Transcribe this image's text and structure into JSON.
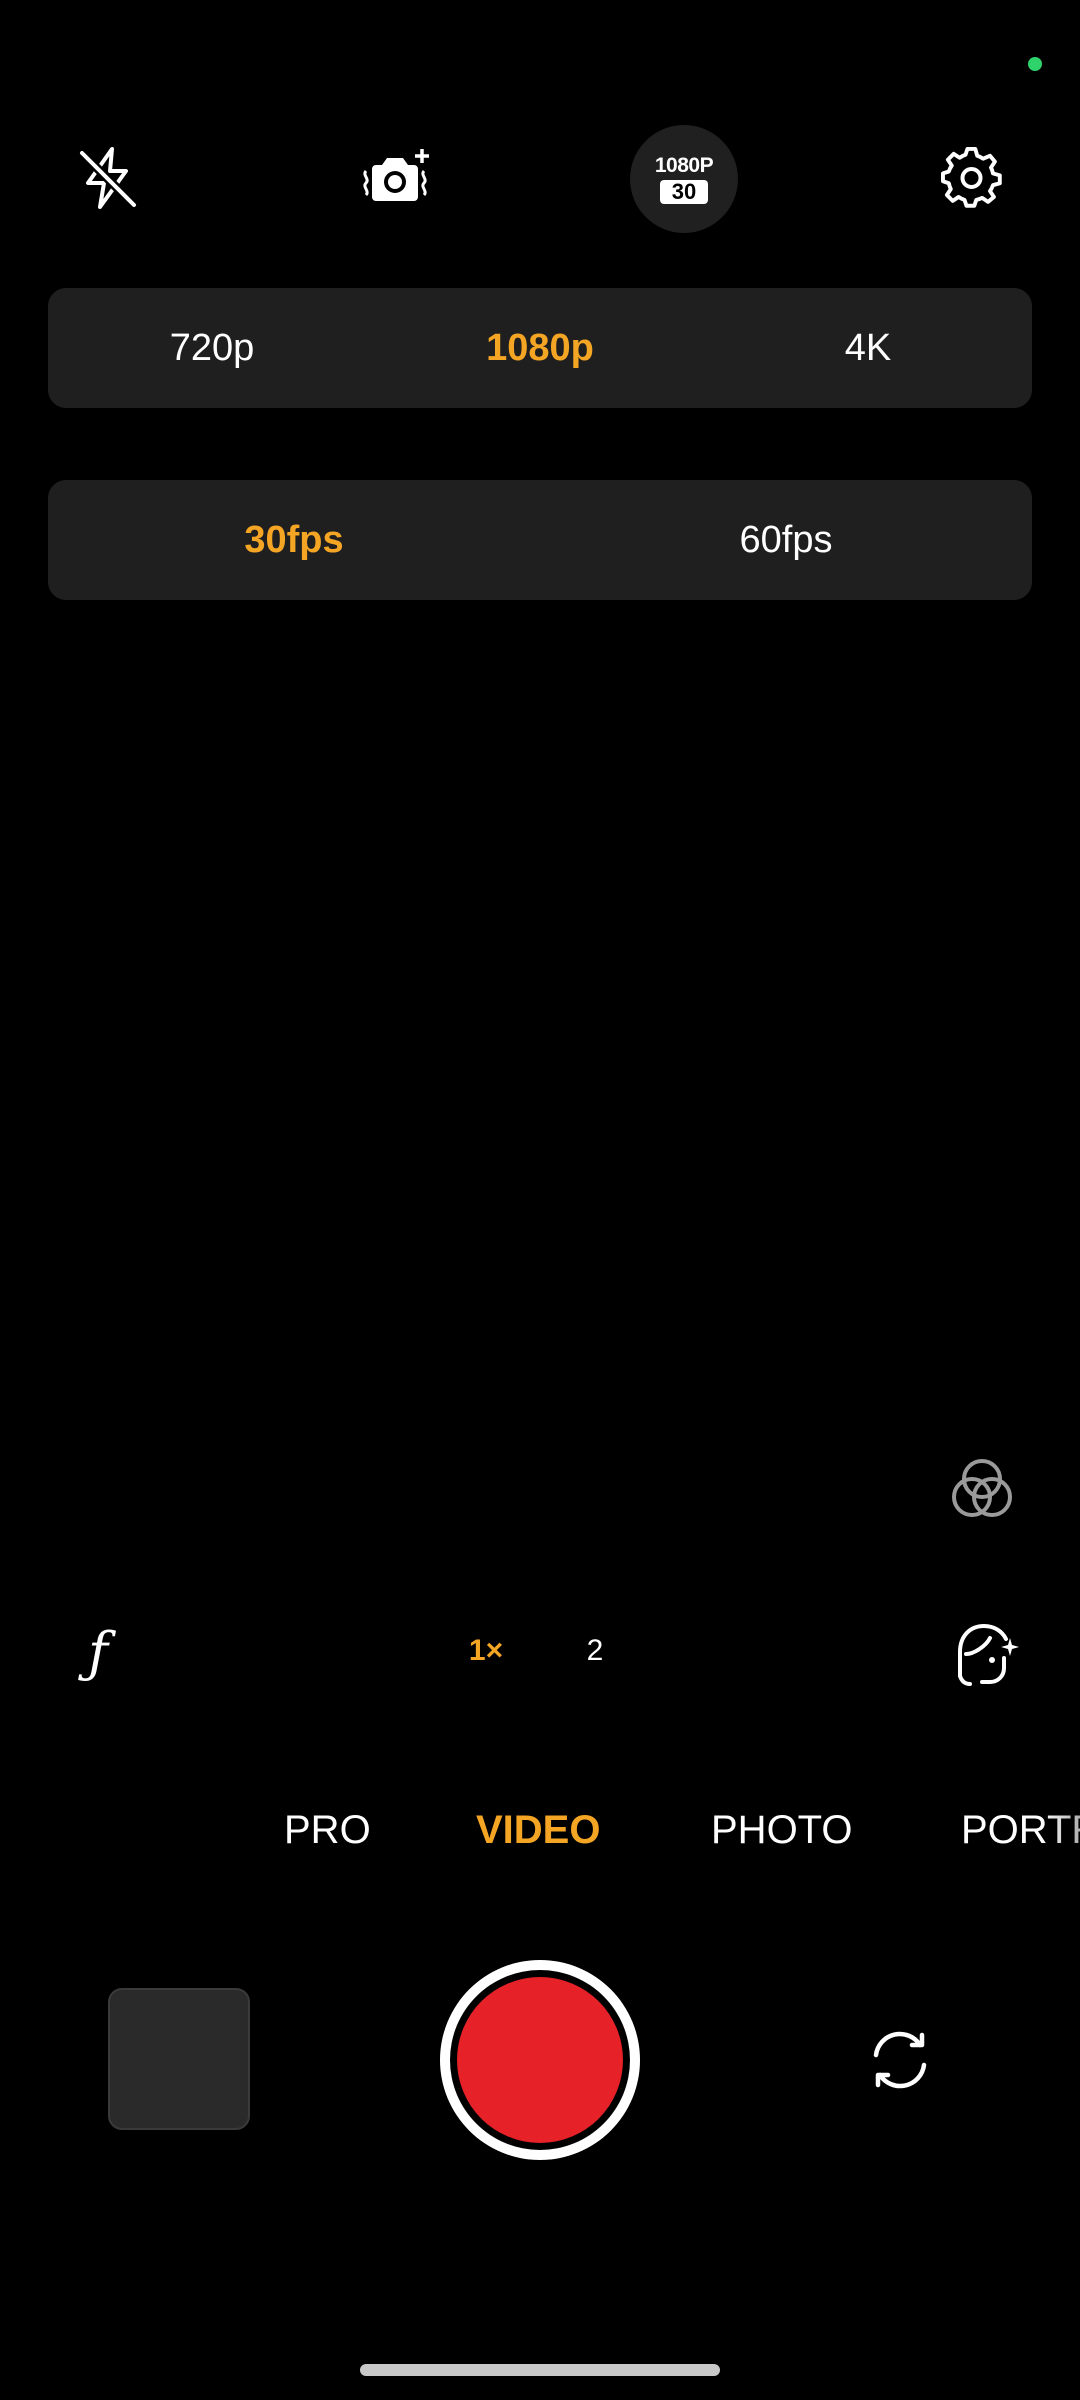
{
  "colors": {
    "accent": "#f5a524",
    "record": "#e62128",
    "panel": "#1f1f1f",
    "status_dot": "#2fd36b"
  },
  "top_bar": {
    "flash_icon": "flash-off-icon",
    "add_camera_icon": "camera-add-icon",
    "resolution_badge": {
      "line1": "1080P",
      "line2": "30"
    },
    "settings_icon": "gear-icon"
  },
  "resolution_options": {
    "items": [
      "720p",
      "1080p",
      "4K"
    ],
    "selected": "1080p"
  },
  "fps_options": {
    "items": [
      "30fps",
      "60fps"
    ],
    "selected": "30fps"
  },
  "side_controls": {
    "filters_icon": "color-filter-icon",
    "f_label": "ƒ",
    "face_icon": "face-retouch-icon"
  },
  "zoom": {
    "items": [
      "1×",
      "2"
    ],
    "selected": "1×"
  },
  "modes": {
    "items": [
      "PRO",
      "VIDEO",
      "PHOTO",
      "PORTRAIT"
    ],
    "selected": "VIDEO"
  },
  "bottom_bar": {
    "gallery_icon": "gallery-thumbnail",
    "record_icon": "record-button",
    "flip_icon": "switch-camera-icon"
  }
}
